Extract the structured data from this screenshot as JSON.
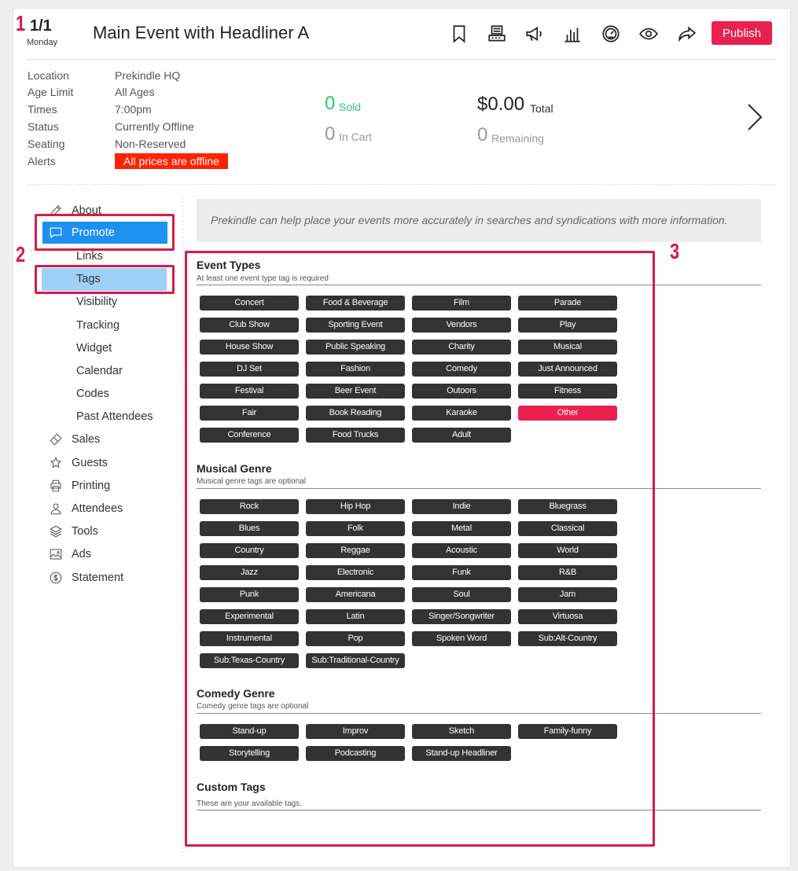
{
  "annotations": [
    "1",
    "2",
    "3"
  ],
  "header": {
    "date": "1/1",
    "day": "Monday",
    "title": "Main Event with Headliner A",
    "publish_label": "Publish",
    "icons": [
      "bookmark-icon",
      "register-icon",
      "megaphone-icon",
      "bar-chart-icon",
      "gauge-icon",
      "eye-icon",
      "share-icon"
    ]
  },
  "details": [
    {
      "label": "Location",
      "value": "Prekindle HQ"
    },
    {
      "label": "Age Limit",
      "value": "All Ages"
    },
    {
      "label": "Times",
      "value": "7:00pm"
    },
    {
      "label": "Status",
      "value": "Currently Offline"
    },
    {
      "label": "Seating",
      "value": "Non-Reserved"
    },
    {
      "label": "Alerts",
      "value": "All prices are offline"
    }
  ],
  "stats": {
    "sold": {
      "value": "0",
      "label": "Sold"
    },
    "in_cart": {
      "value": "0",
      "label": "In Cart"
    },
    "total": {
      "value": "$0.00",
      "label": "Total"
    },
    "remaining": {
      "value": "0",
      "label": "Remaining"
    }
  },
  "sidebar": {
    "about": "About",
    "promote": "Promote",
    "promote_sub": [
      "Links",
      "Tags",
      "Visibility",
      "Tracking",
      "Widget",
      "Calendar",
      "Codes",
      "Past Attendees"
    ],
    "items": [
      "Sales",
      "Guests",
      "Printing",
      "Attendees",
      "Tools",
      "Ads",
      "Statement"
    ]
  },
  "banner": "Prekindle can help place your events more accurately in searches and syndications with more information.",
  "sections": [
    {
      "title": "Event Types",
      "subtitle": "At least one event type tag is required",
      "tags": [
        "Concert",
        "Food & Beverage",
        "Film",
        "Parade",
        "Club Show",
        "Sporting Event",
        "Vendors",
        "Play",
        "House Show",
        "Public Speaking",
        "Charity",
        "Musical",
        "DJ Set",
        "Fashion",
        "Comedy",
        "Just Announced",
        "Festival",
        "Beer Event",
        "Outoors",
        "Fitness",
        "Fair",
        "Book Reading",
        "Karaoke",
        "Other",
        "Conference",
        "Food Trucks",
        "Adult"
      ],
      "selected": [
        "Other"
      ]
    },
    {
      "title": "Musical Genre",
      "subtitle": "Musical genre tags are optional",
      "tags": [
        "Rock",
        "Hip Hop",
        "Indie",
        "Bluegrass",
        "Blues",
        "Folk",
        "Metal",
        "Classical",
        "Country",
        "Reggae",
        "Acoustic",
        "World",
        "Jazz",
        "Electronic",
        "Funk",
        "R&B",
        "Punk",
        "Americana",
        "Soul",
        "Jam",
        "Experimental",
        "Latin",
        "Singer/Songwriter",
        "Virtuosa",
        "Instrumental",
        "Pop",
        "Spoken Word",
        "Sub:Alt-Country",
        "Sub:Texas-Country",
        "Sub:Traditional-Country"
      ],
      "selected": []
    },
    {
      "title": "Comedy Genre",
      "subtitle": "Comedy genre tags are optional",
      "tags": [
        "Stand-up",
        "Improv",
        "Sketch",
        "Family-funny",
        "Storytelling",
        "Podcasting",
        "Stand-up Headliner"
      ],
      "selected": []
    },
    {
      "title": "Custom Tags",
      "subtitle": "These are your available tags.",
      "tags": [],
      "selected": []
    }
  ],
  "colors": {
    "accent": "#e8214f",
    "active_blue": "#1e90f0",
    "sub_active": "#9fd0f7",
    "sold_green": "#2ecc71",
    "alert_red": "#ff2200",
    "annotation": "#d81b4a"
  }
}
